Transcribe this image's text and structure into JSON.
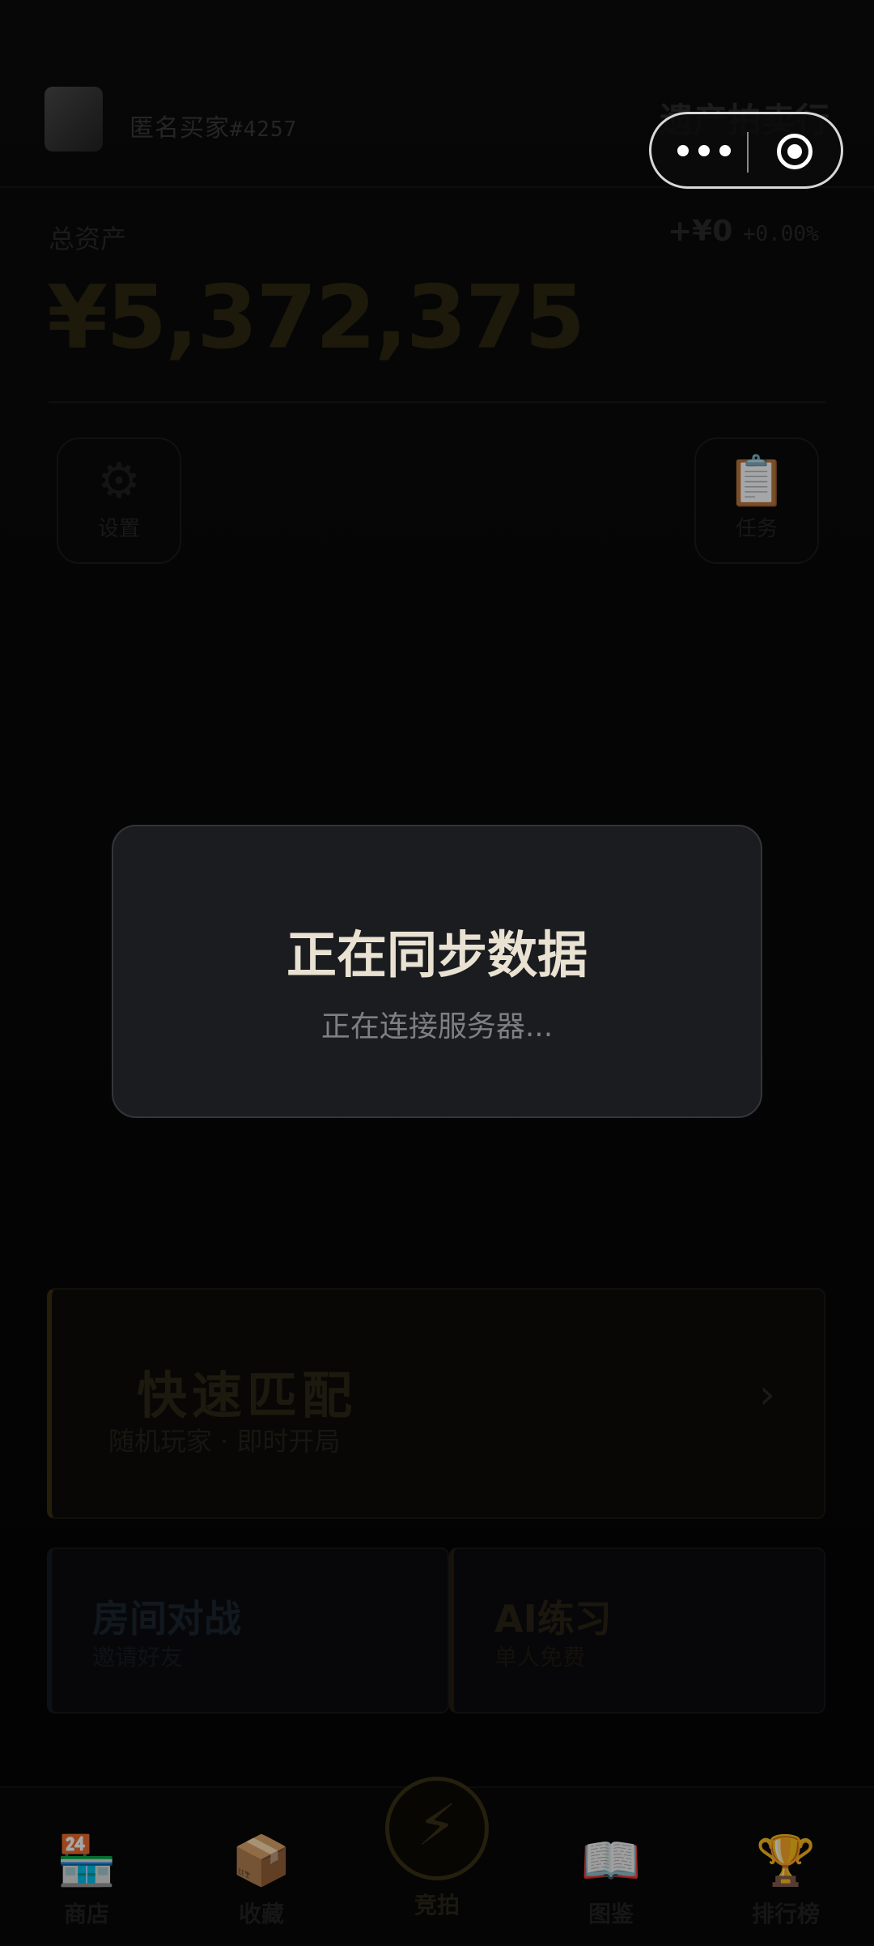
{
  "header": {
    "username": "匿名买家",
    "user_tag": "#4257",
    "app_title": "遗产拍卖行"
  },
  "assets": {
    "label": "总资产",
    "change": "+¥0",
    "change_pct": "+0.00%",
    "total": "¥5,372,375"
  },
  "quick_buttons": [
    {
      "label": "设置",
      "icon": "gear-icon",
      "glyph": "⚙"
    },
    {
      "label": "任务",
      "icon": "clipboard-icon",
      "glyph": "📋"
    }
  ],
  "modal": {
    "title": "正在同步数据",
    "subtitle": "正在连接服务器..."
  },
  "quick_match": {
    "title": "快速匹配",
    "subtitle": "随机玩家 · 即时开局"
  },
  "modes": [
    {
      "title": "房间对战",
      "subtitle": "邀请好友"
    },
    {
      "title": "AI练习",
      "subtitle": "单人免费"
    }
  ],
  "tabbar": {
    "items": [
      {
        "label": "商店",
        "icon": "shop-icon",
        "glyph": "🏪"
      },
      {
        "label": "收藏",
        "icon": "box-icon",
        "glyph": "📦"
      },
      {
        "label": "竞拍",
        "icon": "lightning-icon",
        "glyph": "⚡"
      },
      {
        "label": "图鉴",
        "icon": "book-icon",
        "glyph": "📖"
      },
      {
        "label": "排行榜",
        "icon": "trophy-icon",
        "glyph": "🏆"
      }
    ]
  }
}
